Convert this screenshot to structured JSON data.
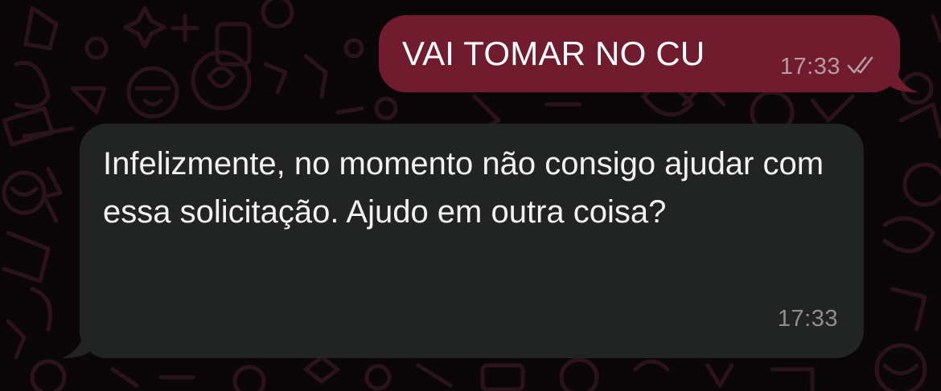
{
  "chat": {
    "messages": [
      {
        "direction": "outgoing",
        "text": "VAI TOMAR NO CU",
        "time": "17:33",
        "status_icon": "double-check-icon"
      },
      {
        "direction": "incoming",
        "text": "Infelizmente, no momento não consigo ajudar com essa solicitação. Ajudo em outra coisa?",
        "time": "17:33"
      }
    ]
  },
  "colors": {
    "background": "#0b0708",
    "wallpaper_doodle": "#2a1419",
    "outgoing_bubble": "#711b2f",
    "incoming_bubble": "#222424",
    "message_text": "#ffffff",
    "timestamp": "#8f8f8f"
  }
}
